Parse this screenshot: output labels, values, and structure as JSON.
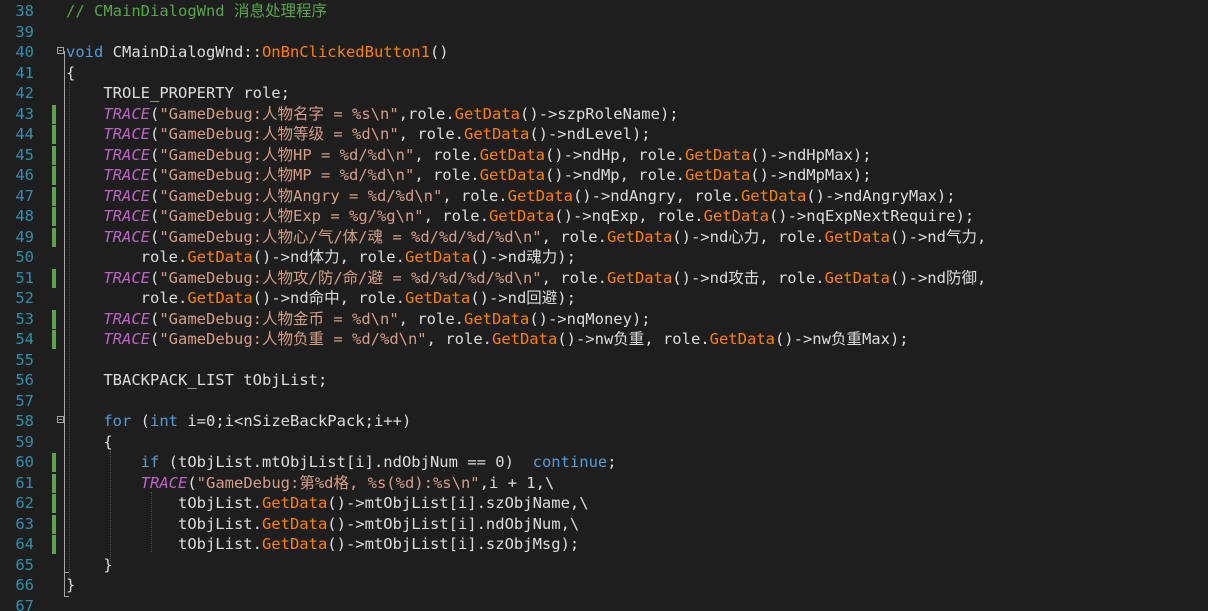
{
  "editor": {
    "colors": {
      "background": "#1e1e1e",
      "default": "#dcdcdc",
      "comment": "#57a64a",
      "keyword": "#569cd6",
      "string": "#d69d85",
      "function": "#ff8000",
      "macro": "#bd63c5",
      "member": "#dadada",
      "line_number": "#2b91af",
      "change_bar": "#57a64a"
    },
    "lines": [
      {
        "num": "38",
        "changed": false,
        "tokens": [
          {
            "t": "// CMainDialogWnd 消息处理程序",
            "c": "comment"
          }
        ]
      },
      {
        "num": "39",
        "changed": false,
        "tokens": []
      },
      {
        "num": "40",
        "changed": false,
        "fold": true,
        "tokens": [
          {
            "t": "void",
            "c": "keyword"
          },
          {
            "t": " CMainDialogWnd::",
            "c": "default"
          },
          {
            "t": "OnBnClickedButton1",
            "c": "function"
          },
          {
            "t": "()",
            "c": "default"
          }
        ]
      },
      {
        "num": "41",
        "changed": false,
        "tokens": [
          {
            "t": "{",
            "c": "default"
          }
        ]
      },
      {
        "num": "42",
        "changed": false,
        "tokens": [
          {
            "t": "    TROLE_PROPERTY role;",
            "c": "default"
          }
        ]
      },
      {
        "num": "43",
        "changed": true,
        "tokens": [
          {
            "t": "    ",
            "c": "default"
          },
          {
            "t": "TRACE",
            "c": "macro"
          },
          {
            "t": "(",
            "c": "default"
          },
          {
            "t": "\"GameDebug:人物名字 = %s\\n\"",
            "c": "string"
          },
          {
            "t": ",role.",
            "c": "default"
          },
          {
            "t": "GetData",
            "c": "function"
          },
          {
            "t": "()->szpRoleName);",
            "c": "default"
          }
        ]
      },
      {
        "num": "44",
        "changed": true,
        "tokens": [
          {
            "t": "    ",
            "c": "default"
          },
          {
            "t": "TRACE",
            "c": "macro"
          },
          {
            "t": "(",
            "c": "default"
          },
          {
            "t": "\"GameDebug:人物等级 = %d\\n\"",
            "c": "string"
          },
          {
            "t": ", role.",
            "c": "default"
          },
          {
            "t": "GetData",
            "c": "function"
          },
          {
            "t": "()->ndLevel);",
            "c": "default"
          }
        ]
      },
      {
        "num": "45",
        "changed": true,
        "tokens": [
          {
            "t": "    ",
            "c": "default"
          },
          {
            "t": "TRACE",
            "c": "macro"
          },
          {
            "t": "(",
            "c": "default"
          },
          {
            "t": "\"GameDebug:人物HP = %d/%d\\n\"",
            "c": "string"
          },
          {
            "t": ", role.",
            "c": "default"
          },
          {
            "t": "GetData",
            "c": "function"
          },
          {
            "t": "()->ndHp, role.",
            "c": "default"
          },
          {
            "t": "GetData",
            "c": "function"
          },
          {
            "t": "()->ndHpMax);",
            "c": "default"
          }
        ]
      },
      {
        "num": "46",
        "changed": true,
        "tokens": [
          {
            "t": "    ",
            "c": "default"
          },
          {
            "t": "TRACE",
            "c": "macro"
          },
          {
            "t": "(",
            "c": "default"
          },
          {
            "t": "\"GameDebug:人物MP = %d/%d\\n\"",
            "c": "string"
          },
          {
            "t": ", role.",
            "c": "default"
          },
          {
            "t": "GetData",
            "c": "function"
          },
          {
            "t": "()->ndMp, role.",
            "c": "default"
          },
          {
            "t": "GetData",
            "c": "function"
          },
          {
            "t": "()->ndMpMax);",
            "c": "default"
          }
        ]
      },
      {
        "num": "47",
        "changed": true,
        "tokens": [
          {
            "t": "    ",
            "c": "default"
          },
          {
            "t": "TRACE",
            "c": "macro"
          },
          {
            "t": "(",
            "c": "default"
          },
          {
            "t": "\"GameDebug:人物Angry = %d/%d\\n\"",
            "c": "string"
          },
          {
            "t": ", role.",
            "c": "default"
          },
          {
            "t": "GetData",
            "c": "function"
          },
          {
            "t": "()->ndAngry, role.",
            "c": "default"
          },
          {
            "t": "GetData",
            "c": "function"
          },
          {
            "t": "()->ndAngryMax);",
            "c": "default"
          }
        ]
      },
      {
        "num": "48",
        "changed": true,
        "tokens": [
          {
            "t": "    ",
            "c": "default"
          },
          {
            "t": "TRACE",
            "c": "macro"
          },
          {
            "t": "(",
            "c": "default"
          },
          {
            "t": "\"GameDebug:人物Exp = %g/%g\\n\"",
            "c": "string"
          },
          {
            "t": ", role.",
            "c": "default"
          },
          {
            "t": "GetData",
            "c": "function"
          },
          {
            "t": "()->nqExp, role.",
            "c": "default"
          },
          {
            "t": "GetData",
            "c": "function"
          },
          {
            "t": "()->nqExpNextRequire);",
            "c": "default"
          }
        ]
      },
      {
        "num": "49",
        "changed": true,
        "tokens": [
          {
            "t": "    ",
            "c": "default"
          },
          {
            "t": "TRACE",
            "c": "macro"
          },
          {
            "t": "(",
            "c": "default"
          },
          {
            "t": "\"GameDebug:人物心/气/体/魂 = %d/%d/%d/%d\\n\"",
            "c": "string"
          },
          {
            "t": ", role.",
            "c": "default"
          },
          {
            "t": "GetData",
            "c": "function"
          },
          {
            "t": "()->nd心力, role.",
            "c": "default"
          },
          {
            "t": "GetData",
            "c": "function"
          },
          {
            "t": "()->nd气力,",
            "c": "default"
          }
        ]
      },
      {
        "num": "50",
        "changed": false,
        "tokens": [
          {
            "t": "        role.",
            "c": "default"
          },
          {
            "t": "GetData",
            "c": "function"
          },
          {
            "t": "()->nd体力, role.",
            "c": "default"
          },
          {
            "t": "GetData",
            "c": "function"
          },
          {
            "t": "()->nd魂力);",
            "c": "default"
          }
        ]
      },
      {
        "num": "51",
        "changed": true,
        "tokens": [
          {
            "t": "    ",
            "c": "default"
          },
          {
            "t": "TRACE",
            "c": "macro"
          },
          {
            "t": "(",
            "c": "default"
          },
          {
            "t": "\"GameDebug:人物攻/防/命/避 = %d/%d/%d/%d\\n\"",
            "c": "string"
          },
          {
            "t": ", role.",
            "c": "default"
          },
          {
            "t": "GetData",
            "c": "function"
          },
          {
            "t": "()->nd攻击, role.",
            "c": "default"
          },
          {
            "t": "GetData",
            "c": "function"
          },
          {
            "t": "()->nd防御,",
            "c": "default"
          }
        ]
      },
      {
        "num": "52",
        "changed": false,
        "tokens": [
          {
            "t": "        role.",
            "c": "default"
          },
          {
            "t": "GetData",
            "c": "function"
          },
          {
            "t": "()->nd命中, role.",
            "c": "default"
          },
          {
            "t": "GetData",
            "c": "function"
          },
          {
            "t": "()->nd回避);",
            "c": "default"
          }
        ]
      },
      {
        "num": "53",
        "changed": true,
        "tokens": [
          {
            "t": "    ",
            "c": "default"
          },
          {
            "t": "TRACE",
            "c": "macro"
          },
          {
            "t": "(",
            "c": "default"
          },
          {
            "t": "\"GameDebug:人物金币 = %d\\n\"",
            "c": "string"
          },
          {
            "t": ", role.",
            "c": "default"
          },
          {
            "t": "GetData",
            "c": "function"
          },
          {
            "t": "()->nqMoney);",
            "c": "default"
          }
        ]
      },
      {
        "num": "54",
        "changed": true,
        "tokens": [
          {
            "t": "    ",
            "c": "default"
          },
          {
            "t": "TRACE",
            "c": "macro"
          },
          {
            "t": "(",
            "c": "default"
          },
          {
            "t": "\"GameDebug:人物负重 = %d/%d\\n\"",
            "c": "string"
          },
          {
            "t": ", role.",
            "c": "default"
          },
          {
            "t": "GetData",
            "c": "function"
          },
          {
            "t": "()->nw负重, role.",
            "c": "default"
          },
          {
            "t": "GetData",
            "c": "function"
          },
          {
            "t": "()->nw负重Max);",
            "c": "default"
          }
        ]
      },
      {
        "num": "55",
        "changed": false,
        "tokens": []
      },
      {
        "num": "56",
        "changed": false,
        "tokens": [
          {
            "t": "    TBACKPACK_LIST tObjList;",
            "c": "default"
          }
        ]
      },
      {
        "num": "57",
        "changed": false,
        "tokens": []
      },
      {
        "num": "58",
        "changed": false,
        "fold": true,
        "tokens": [
          {
            "t": "    ",
            "c": "default"
          },
          {
            "t": "for",
            "c": "keyword"
          },
          {
            "t": " (",
            "c": "default"
          },
          {
            "t": "int",
            "c": "keyword"
          },
          {
            "t": " i=0;i<nSizeBackPack;i++)",
            "c": "default"
          }
        ]
      },
      {
        "num": "59",
        "changed": false,
        "tokens": [
          {
            "t": "    {",
            "c": "default"
          }
        ]
      },
      {
        "num": "60",
        "changed": true,
        "tokens": [
          {
            "t": "        ",
            "c": "default"
          },
          {
            "t": "if",
            "c": "keyword"
          },
          {
            "t": " (tObjList.mtObjList[i].ndObjNum == 0)  ",
            "c": "default"
          },
          {
            "t": "continue",
            "c": "keyword"
          },
          {
            "t": ";",
            "c": "default"
          }
        ]
      },
      {
        "num": "61",
        "changed": true,
        "tokens": [
          {
            "t": "        ",
            "c": "default"
          },
          {
            "t": "TRACE",
            "c": "macro"
          },
          {
            "t": "(",
            "c": "default"
          },
          {
            "t": "\"GameDebug:第%d格, %s(%d):%s\\n\"",
            "c": "string"
          },
          {
            "t": ",i + 1,\\",
            "c": "default"
          }
        ]
      },
      {
        "num": "62",
        "changed": true,
        "tokens": [
          {
            "t": "            tObjList.",
            "c": "default"
          },
          {
            "t": "GetData",
            "c": "function"
          },
          {
            "t": "()->mtObjList[i].szObjName,\\",
            "c": "default"
          }
        ]
      },
      {
        "num": "63",
        "changed": true,
        "tokens": [
          {
            "t": "            tObjList.",
            "c": "default"
          },
          {
            "t": "GetData",
            "c": "function"
          },
          {
            "t": "()->mtObjList[i].ndObjNum,\\",
            "c": "default"
          }
        ]
      },
      {
        "num": "64",
        "changed": true,
        "tokens": [
          {
            "t": "            tObjList.",
            "c": "default"
          },
          {
            "t": "GetData",
            "c": "function"
          },
          {
            "t": "()->mtObjList[i].szObjMsg);",
            "c": "default"
          }
        ]
      },
      {
        "num": "65",
        "changed": false,
        "tokens": [
          {
            "t": "    }",
            "c": "default"
          }
        ]
      },
      {
        "num": "66",
        "changed": false,
        "tokens": [
          {
            "t": "}",
            "c": "default"
          }
        ]
      },
      {
        "num": "67",
        "changed": false,
        "tokens": []
      }
    ]
  }
}
